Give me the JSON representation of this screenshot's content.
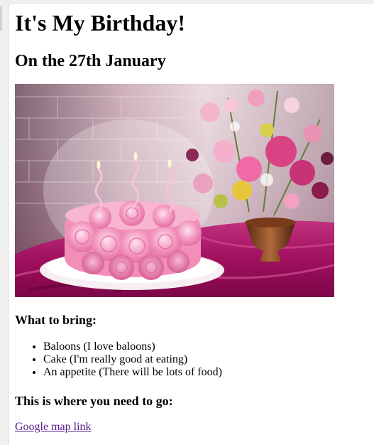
{
  "page": {
    "title": "It's My Birthday!",
    "date_heading": "On the 27th January"
  },
  "image": {
    "subject": "cake-photo"
  },
  "bring": {
    "heading": "What to bring:",
    "items": [
      "Baloons (I love baloons)",
      "Cake (I'm really good at eating)",
      "An appetite (There will be lots of food)"
    ]
  },
  "directions": {
    "heading": "This is where you need to go:",
    "link_label": "Google map link"
  },
  "colors": {
    "link_visited": "#551a8b",
    "page_bg": "#ffffff"
  }
}
